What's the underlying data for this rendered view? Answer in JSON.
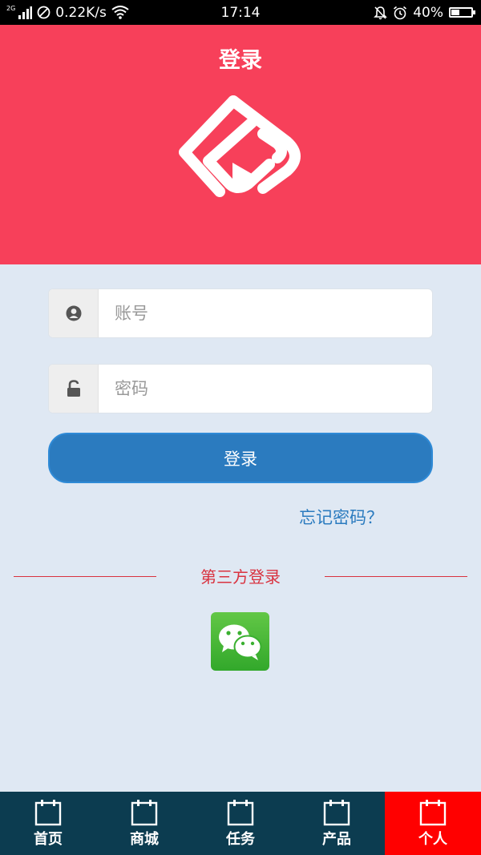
{
  "status_bar": {
    "network_type": "2G",
    "speed": "0.22K/s",
    "time": "17:14",
    "battery": "40%",
    "battery_level": 0.4
  },
  "header": {
    "title": "登录",
    "background_color": "#f7405a"
  },
  "form": {
    "account_placeholder": "账号",
    "password_placeholder": "密码",
    "login_button": "登录",
    "forgot_password": "忘记密码？"
  },
  "third_party": {
    "label": "第三方登录",
    "providers": [
      "wechat-icon"
    ]
  },
  "tabbar": {
    "tabs": [
      {
        "label": "首页",
        "active": false
      },
      {
        "label": "商城",
        "active": false
      },
      {
        "label": "任务",
        "active": false
      },
      {
        "label": "产品",
        "active": false
      },
      {
        "label": "个人",
        "active": true
      }
    ],
    "background_color": "#0c3c50",
    "active_color": "#ff0000"
  },
  "colors": {
    "accent_blue": "#2b7bbf",
    "divider_red": "#d9323f",
    "page_background": "#dfe8f3"
  }
}
